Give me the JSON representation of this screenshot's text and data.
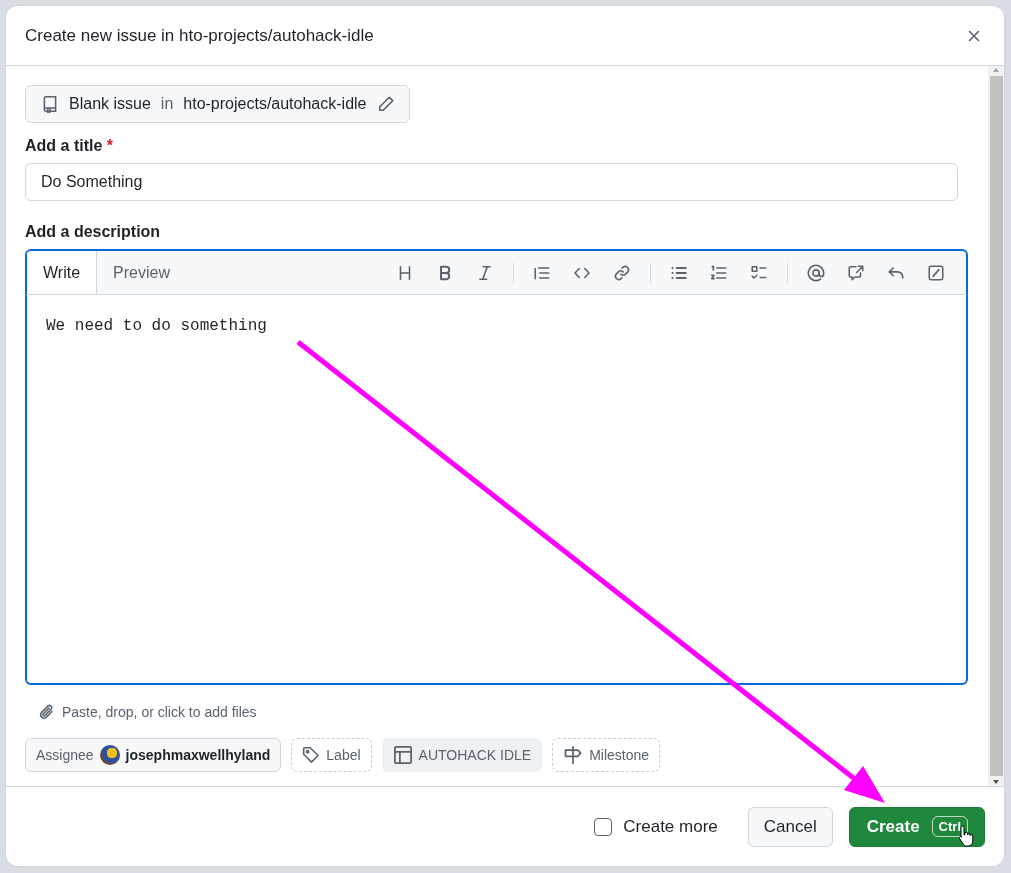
{
  "dialog": {
    "title": "Create new issue in hto-projects/autohack-idle"
  },
  "template": {
    "name": "Blank issue",
    "connector": "in",
    "repo": "hto-projects/autohack-idle"
  },
  "title_field": {
    "label": "Add a title",
    "required_mark": "*",
    "value": "Do Something"
  },
  "description": {
    "label": "Add a description",
    "tabs": [
      {
        "label": "Write",
        "selected": true
      },
      {
        "label": "Preview",
        "selected": false
      }
    ],
    "value": "We need to do something",
    "attach_hint": "Paste, drop, or click to add files"
  },
  "metadata": [
    {
      "kind": "assignee",
      "label": "Assignee",
      "value": "josephmaxwellhyland"
    },
    {
      "kind": "label",
      "label": "Label"
    },
    {
      "kind": "project",
      "label": "AUTOHACK IDLE"
    },
    {
      "kind": "milestone",
      "label": "Milestone"
    }
  ],
  "footer": {
    "create_more": {
      "label": "Create more",
      "checked": false
    },
    "cancel": "Cancel",
    "create": "Create",
    "shortcut": "Ctrl"
  }
}
